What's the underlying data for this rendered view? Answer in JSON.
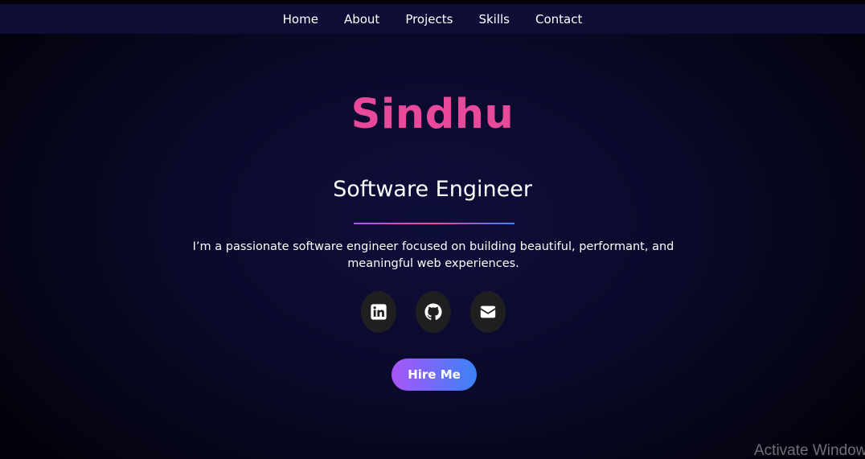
{
  "nav": {
    "items": [
      {
        "label": "Home"
      },
      {
        "label": "About"
      },
      {
        "label": "Projects"
      },
      {
        "label": "Skills"
      },
      {
        "label": "Contact"
      }
    ]
  },
  "hero": {
    "name": "Sindhu",
    "role": "Software Engineer",
    "description": "I’m a passionate software engineer focused on building beautiful, performant, and meaningful web experiences.",
    "cta_label": "Hire Me"
  },
  "social": [
    {
      "icon": "linkedin-icon"
    },
    {
      "icon": "github-icon"
    },
    {
      "icon": "envelope-icon"
    }
  ],
  "colors": {
    "name": "#e9499b",
    "nav_background": "#0d0d36",
    "cta_gradient": [
      "#a855f7",
      "#3b82f6"
    ],
    "divider_gradient": [
      "#a855f7",
      "#ec4899",
      "#3b82f6"
    ],
    "social_button": "#1f1f22"
  },
  "system": {
    "watermark": "Activate Windows"
  }
}
